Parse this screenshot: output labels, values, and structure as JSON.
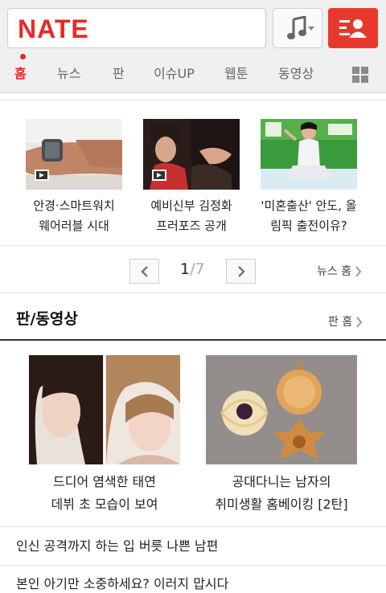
{
  "header": {
    "logo": "NATE",
    "search_placeholder": "",
    "music_icon": "music-note-icon",
    "user_icon": "user-menu-icon",
    "accent_color": "#e62b26"
  },
  "nav": {
    "items": [
      "홈",
      "뉴스",
      "판",
      "이슈UP",
      "웹툰",
      "동영상"
    ],
    "active_index": 0,
    "more_icon": "grid-icon"
  },
  "news": {
    "cards": [
      {
        "line1": "안경·스마트워치",
        "line2": "웨어러블 시대",
        "video": true
      },
      {
        "line1": "예비신부 김정화",
        "line2": "프러포즈 공개",
        "video": true
      },
      {
        "line1": "'미혼출산' 안도, 올",
        "line2": "림픽 출전이유?",
        "video": false
      }
    ],
    "pager": {
      "current": "1",
      "total": "/7"
    },
    "more_label": "뉴스 홈"
  },
  "pan": {
    "title": "판/동영상",
    "more_label": "판 홈",
    "cards": [
      {
        "line1": "드디어 염색한 태연",
        "line2": "데뷔 초 모습이 보여"
      },
      {
        "line1": "공대다니는 남자의",
        "line2": "취미생활 홈베이킹 [2탄]"
      }
    ],
    "list": [
      "인신 공격까지 하는 입 버릇 나쁜 남편",
      "본인 아기만 소중하세요? 이러지 맙시다"
    ]
  }
}
